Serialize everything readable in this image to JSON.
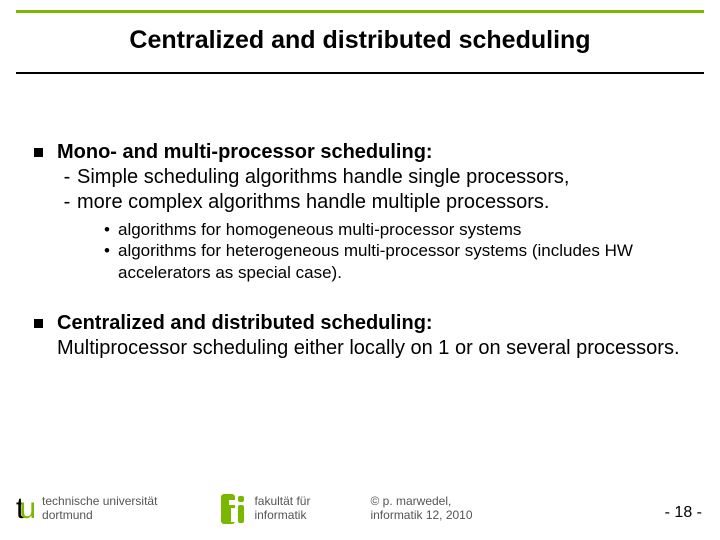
{
  "title": "Centralized and distributed scheduling",
  "bullets": [
    {
      "head": "Mono- and multi-processor scheduling:",
      "dashes": [
        "Simple scheduling algorithms handle single processors,",
        "more complex algorithms handle multiple processors."
      ],
      "dots": [
        "algorithms for homogeneous multi-processor systems",
        "algorithms for heterogeneous multi-processor systems (includes HW accelerators as special case)."
      ],
      "body": ""
    },
    {
      "head": "Centralized and distributed scheduling:",
      "body": "Multiprocessor scheduling either locally on 1 or on several processors.",
      "dashes": [],
      "dots": []
    }
  ],
  "footer": {
    "uni_line1": "technische universität",
    "uni_line2": "dortmund",
    "fak_line1": "fakultät für",
    "fak_line2": "informatik",
    "copy_line1": "©  p. marwedel,",
    "copy_line2": "informatik 12,  2010"
  },
  "page": "-  18 -"
}
